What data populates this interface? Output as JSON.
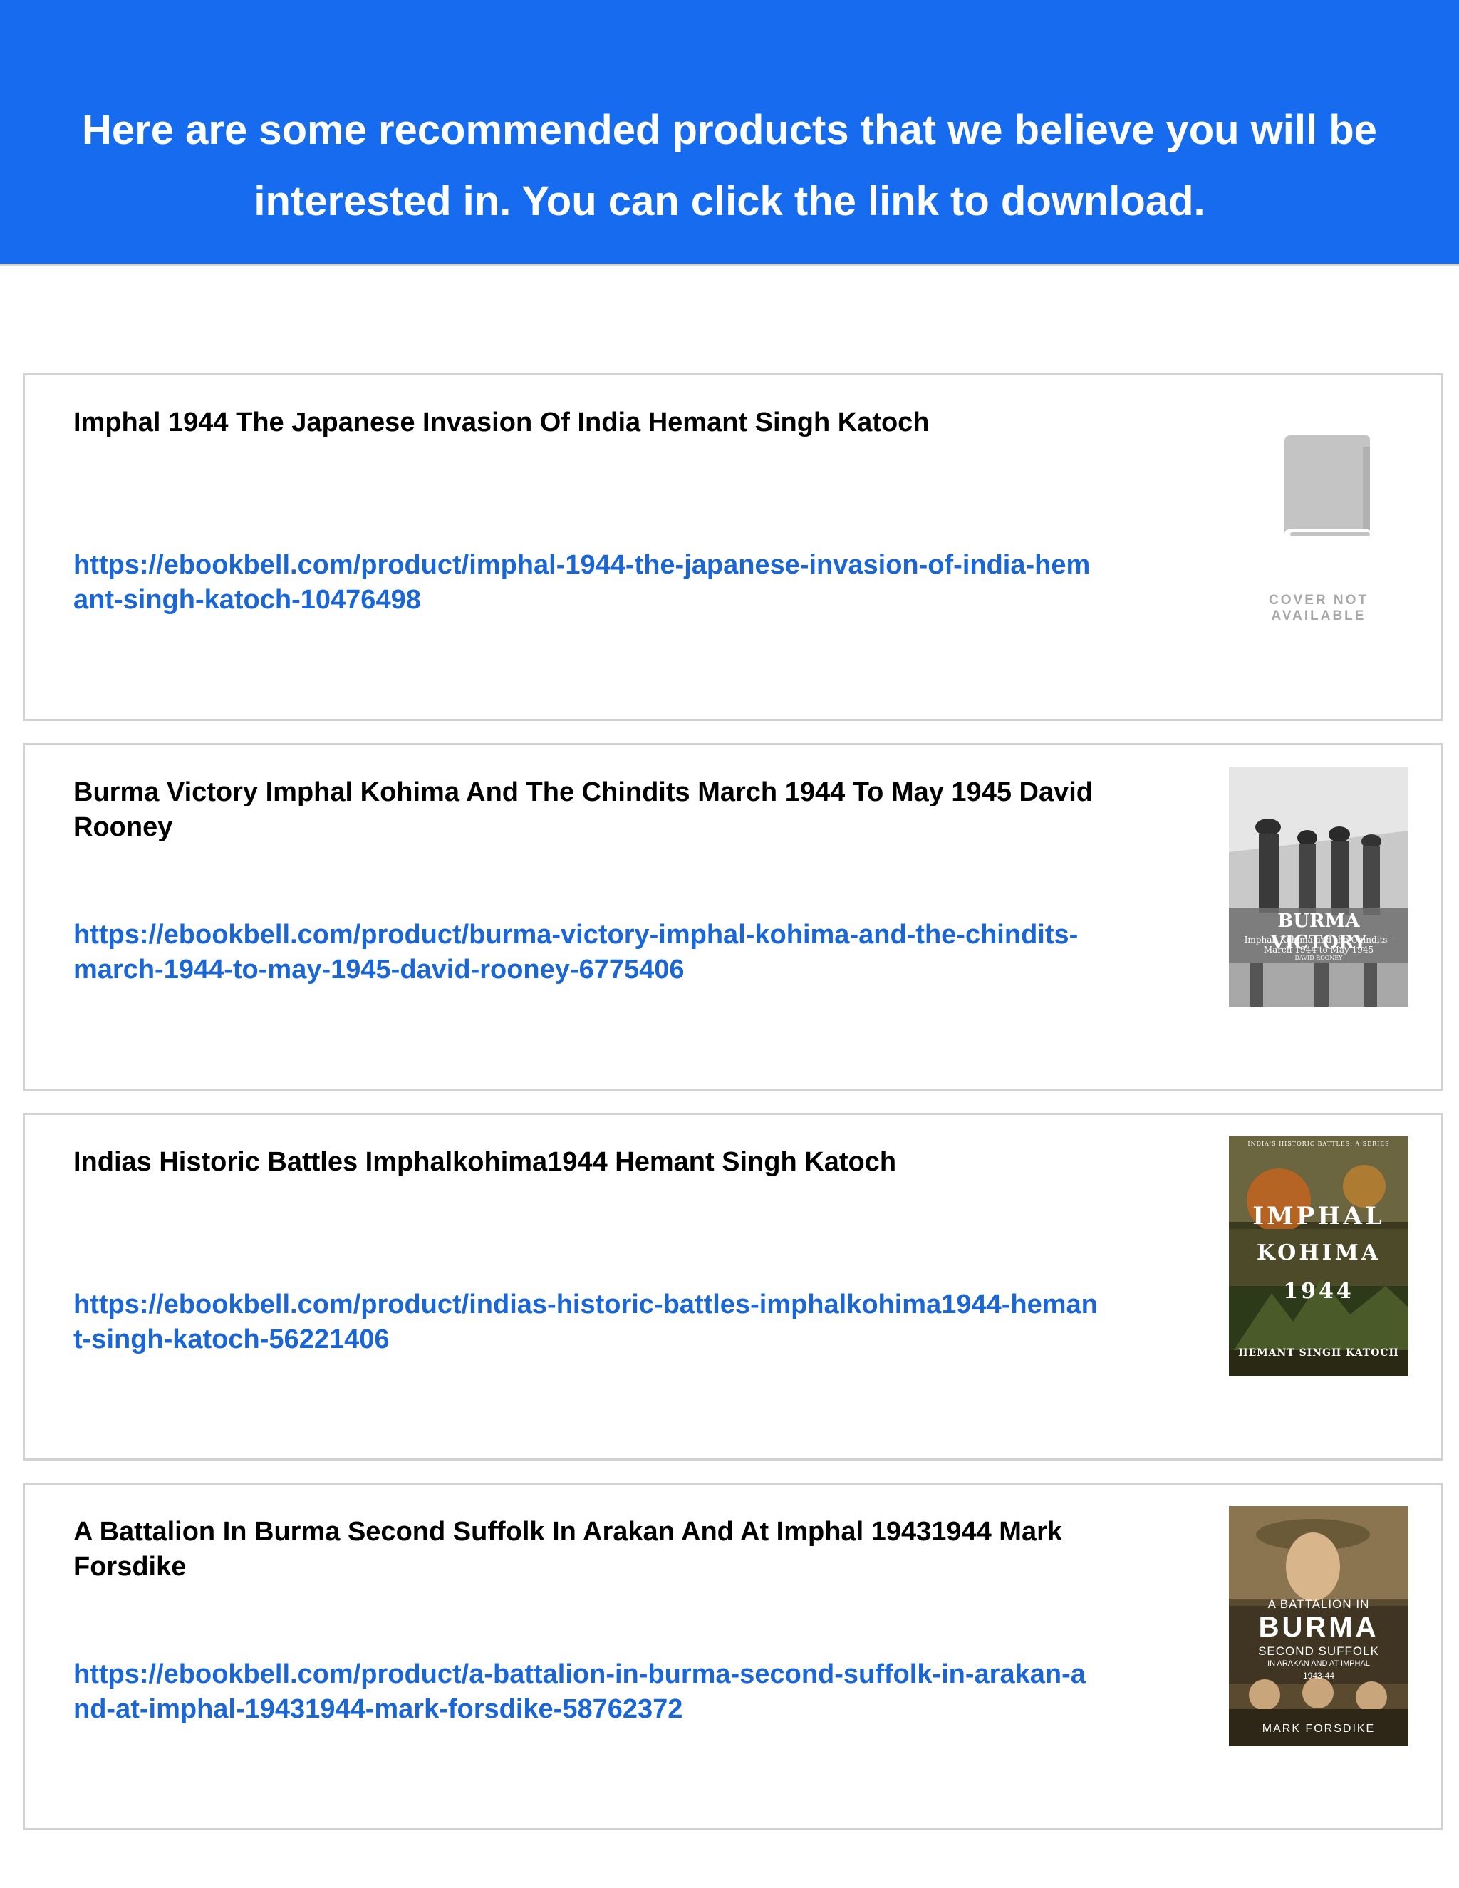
{
  "header": {
    "message": "Here are some recommended products that we believe you will be interested in. You can click the link to download."
  },
  "products": [
    {
      "title": "Imphal 1944 The Japanese Invasion Of India Hemant Singh Katoch",
      "url": "https://ebookbell.com/product/imphal-1944-the-japanese-invasion-of-india-hemant-singh-katoch-10476498",
      "cover": {
        "label": "COVER NOT AVAILABLE"
      }
    },
    {
      "title": "Burma Victory Imphal Kohima And The Chindits March 1944 To May 1945 David Rooney",
      "url": "https://ebookbell.com/product/burma-victory-imphal-kohima-and-the-chindits-march-1944-to-may-1945-david-rooney-6775406",
      "cover": {
        "title": "BURMA VICTORY",
        "subtitle": "Imphal, Kohima and the Chindits - March 1944 to May 1945",
        "author": "DAVID ROONEY"
      }
    },
    {
      "title": "Indias Historic Battles Imphalkohima1944 Hemant Singh Katoch",
      "url": "https://ebookbell.com/product/indias-historic-battles-imphalkohima1944-hemant-singh-katoch-56221406",
      "cover": {
        "series": "INDIA'S HISTORIC BATTLES: A SERIES",
        "line1": "IMPHAL",
        "line2": "KOHIMA",
        "line3": "1944",
        "author": "HEMANT SINGH KATOCH"
      }
    },
    {
      "title": "A Battalion In Burma Second Suffolk In Arakan And At Imphal 19431944 Mark Forsdike",
      "url": "https://ebookbell.com/product/a-battalion-in-burma-second-suffolk-in-arakan-and-at-imphal-19431944-mark-forsdike-58762372",
      "cover": {
        "line1": "A BATTALION IN",
        "line2": "BURMA",
        "line3": "SECOND SUFFOLK",
        "line4": "IN ARAKAN AND AT IMPHAL",
        "line5": "1943-44",
        "author": "MARK FORSDIKE"
      }
    }
  ],
  "colors": {
    "header_bg": "#166bee",
    "link": "#1a66d6",
    "card_border": "#d2d2d2"
  }
}
